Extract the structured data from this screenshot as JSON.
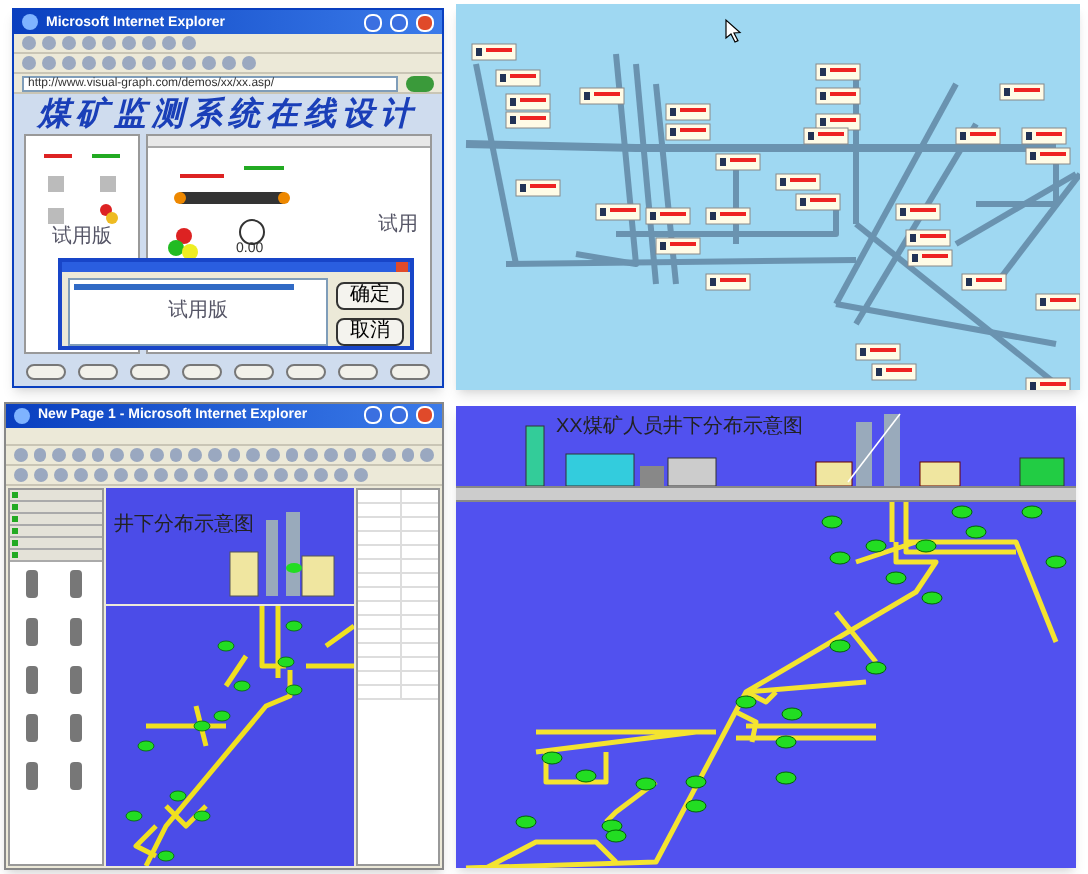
{
  "windows": [
    {
      "kind": "browser",
      "title": "Microsoft Internet Explorer",
      "address": "http://www.visual-graph.com/demos/xx/xx.asp/",
      "heading": "煤矿监测系统在线设计",
      "reading": "0.00",
      "watermarks": [
        "试用版",
        "试用"
      ],
      "dialog": {
        "watermark": "试用版",
        "buttons": [
          "确定",
          "取消"
        ]
      }
    },
    {
      "kind": "map"
    },
    {
      "kind": "editor",
      "title": "New Page 1 - Microsoft Internet Explorer",
      "diagram_title": "井下分布示意图"
    },
    {
      "kind": "diagram",
      "title": "XX煤矿人员井下分布示意图"
    }
  ]
}
